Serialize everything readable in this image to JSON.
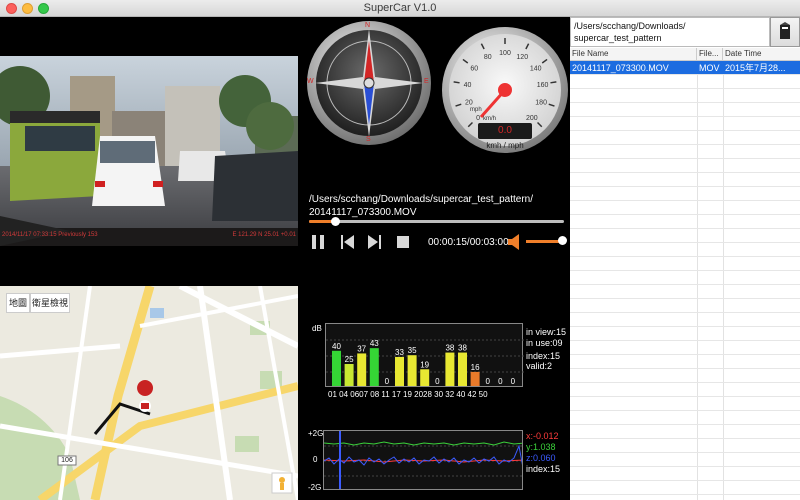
{
  "window": {
    "title": "SuperCar V1.0"
  },
  "video": {
    "overlay_left": "2014/11/17  07:33:15  Previously 153",
    "overlay_right": "E 121.29  N 25.01  +0.01"
  },
  "map": {
    "tab_map": "地圖",
    "tab_satellite": "衛星檢視",
    "route_badge": "106"
  },
  "speedometer": {
    "unit_mph": "mph",
    "unit_kmh": "km/h",
    "footer_label": "kmh / mph",
    "speed_value": "0.0",
    "ticks": [
      "0",
      "20",
      "40",
      "60",
      "80",
      "100",
      "120",
      "140",
      "160",
      "180",
      "200"
    ]
  },
  "compass": {
    "dirs": [
      "N",
      "E",
      "S",
      "W"
    ]
  },
  "player": {
    "path_line1": "/Users/scchang/Downloads/supercar_test_pattern/",
    "path_line2": "20141117_073300.MOV",
    "progress": 0.1,
    "time_text": "00:00:15/00:03:00",
    "volume": 1.0
  },
  "satellites": {
    "db_label": "dB",
    "in_view": "in view:15",
    "in_use": "in use:09",
    "index": "index:15",
    "valid": "valid:2",
    "bars": [
      {
        "id": "01",
        "value": 40,
        "color": "#35d535"
      },
      {
        "id": "04",
        "value": 25,
        "color": "#c8e832"
      },
      {
        "id": "06",
        "value": 37,
        "color": "#e8e832"
      },
      {
        "id": "07",
        "value": 43,
        "color": "#35d535"
      },
      {
        "id": "08",
        "value": 0,
        "color": "#e87a2a"
      },
      {
        "id": "11",
        "value": 33,
        "color": "#e8e832"
      },
      {
        "id": "17",
        "value": 35,
        "color": "#e8e832"
      },
      {
        "id": "19",
        "value": 19,
        "color": "#e8e832"
      },
      {
        "id": "20",
        "value": 0,
        "color": "#e87a2a"
      },
      {
        "id": "28",
        "value": 38,
        "color": "#e8e832"
      },
      {
        "id": "30",
        "value": 38,
        "color": "#e8e832"
      },
      {
        "id": "32",
        "value": 16,
        "color": "#e87a2a"
      },
      {
        "id": "40",
        "value": 0,
        "color": "#e87a2a"
      },
      {
        "id": "42",
        "value": 0,
        "color": "#e87a2a"
      },
      {
        "id": "50",
        "value": 0,
        "color": "#e87a2a"
      }
    ],
    "axis_labels": [
      "01",
      "04",
      "0607",
      "08",
      "11",
      "17",
      "19",
      "2028",
      "30",
      "32",
      "40",
      "42",
      "50"
    ]
  },
  "accelerometer": {
    "axis_top": "+2G",
    "axis_mid": "0",
    "axis_bottom": "-2G",
    "x_val": "x:-0.012",
    "y_val": "y:1.038",
    "z_val": "z:0.060",
    "index": "index:15",
    "colors": {
      "x": "#ff3b3b",
      "y": "#3bd23b",
      "z": "#3b5bff"
    }
  },
  "files": {
    "path": "/Users/scchang/Downloads/\nsupercar_test_pattern",
    "col_name": "File Name",
    "col_ext": "File...",
    "col_date": "Date Time",
    "rows": [
      {
        "name": "20141117_073300.MOV",
        "ext": "MOV",
        "date": "2015年7月28..."
      }
    ]
  }
}
